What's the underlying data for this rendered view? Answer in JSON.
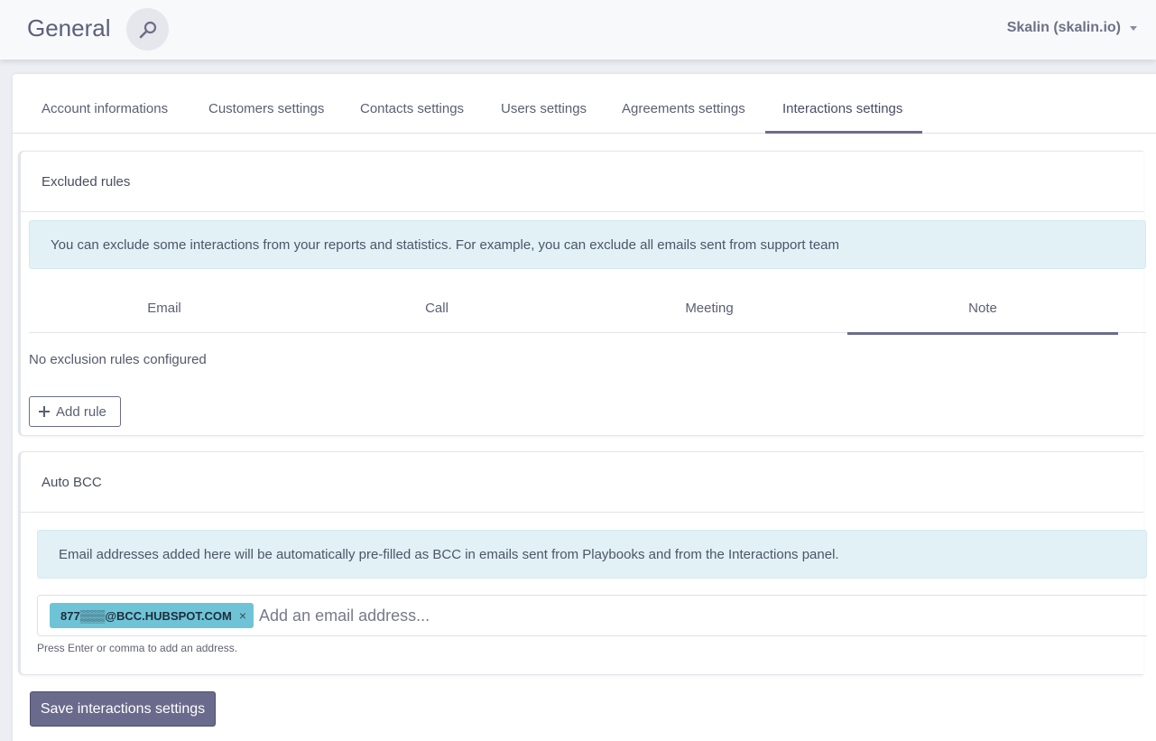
{
  "header": {
    "title": "General",
    "search_icon": "search-icon",
    "user_label": "Skalin (skalin.io)"
  },
  "tabs": [
    {
      "label": "Account informations"
    },
    {
      "label": "Customers settings"
    },
    {
      "label": "Contacts settings"
    },
    {
      "label": "Users settings"
    },
    {
      "label": "Agreements settings"
    },
    {
      "label": "Interactions settings",
      "active": true
    }
  ],
  "excluded_rules": {
    "title": "Excluded rules",
    "info": "You can exclude some interactions from your reports and statistics. For example, you can exclude all emails sent from support team",
    "sub_tabs": [
      {
        "label": "Email"
      },
      {
        "label": "Call"
      },
      {
        "label": "Meeting"
      },
      {
        "label": "Note",
        "active": true
      }
    ],
    "empty_text": "No exclusion rules configured",
    "add_rule_label": "Add rule"
  },
  "auto_bcc": {
    "title": "Auto BCC",
    "info": "Email addresses added here will be automatically pre-filled as BCC in emails sent from Playbooks and from the Interactions panel.",
    "tags": [
      "877▒▒▒@BCC.HUBSPOT.COM"
    ],
    "placeholder": "Add an email address...",
    "help_text": "Press Enter or comma to add an address."
  },
  "save_label": "Save interactions settings",
  "colors": {
    "accent": "#6a6a8c",
    "info_bg": "#e1f1f6",
    "tag_bg": "#6ec4d6"
  }
}
